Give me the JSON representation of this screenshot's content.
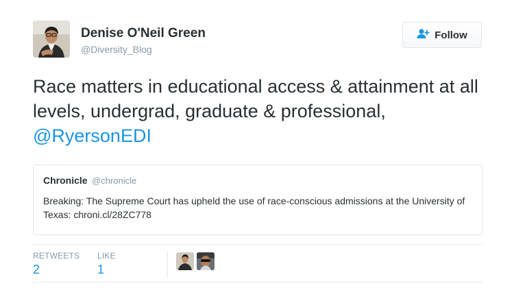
{
  "author": {
    "name": "Denise O'Neil Green",
    "handle": "@Diversity_Blog"
  },
  "follow_label": "Follow",
  "tweet": {
    "text": "Race matters in educational access & attainment at all levels, undergrad, graduate & professional, ",
    "mention": "@RyersonEDI"
  },
  "quote": {
    "name": "Chronicle",
    "handle": "@chronicle",
    "text": "Breaking: The Supreme Court has upheld the use of race-conscious admissions at the University of Texas: chroni.cl/28ZC778"
  },
  "stats": {
    "retweets_label": "RETWEETS",
    "retweets_value": "2",
    "likes_label": "LIKE",
    "likes_value": "1"
  },
  "colors": {
    "link": "#1b95e0",
    "muted": "#8899a6",
    "text": "#292f33",
    "border": "#e1e8ed"
  },
  "icons": [
    "follow-person-plus-icon"
  ]
}
